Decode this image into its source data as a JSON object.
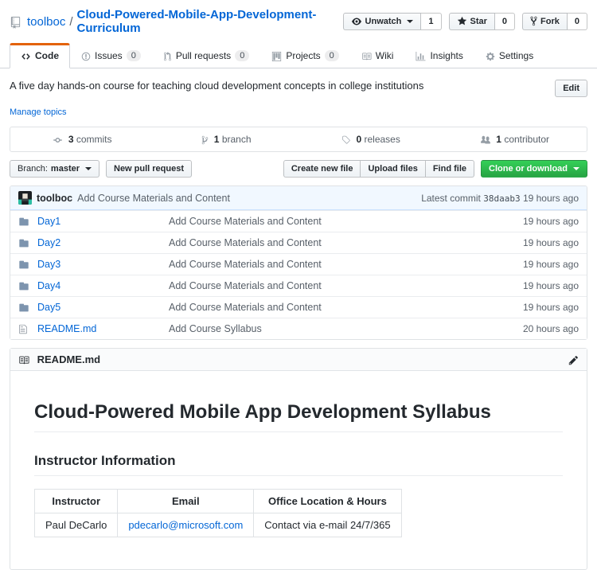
{
  "header": {
    "owner": "toolboc",
    "separator": "/",
    "repo_name": "Cloud-Powered-Mobile-App-Development-Curriculum",
    "watch": {
      "label": "Unwatch",
      "count": "1"
    },
    "star": {
      "label": "Star",
      "count": "0"
    },
    "fork": {
      "label": "Fork",
      "count": "0"
    }
  },
  "tabs": {
    "code": {
      "label": "Code"
    },
    "issues": {
      "label": "Issues",
      "count": "0"
    },
    "pulls": {
      "label": "Pull requests",
      "count": "0"
    },
    "projects": {
      "label": "Projects",
      "count": "0"
    },
    "wiki": {
      "label": "Wiki"
    },
    "insights": {
      "label": "Insights"
    },
    "settings": {
      "label": "Settings"
    }
  },
  "about": {
    "description": "A five day hands-on course for teaching cloud development concepts in college institutions",
    "edit_label": "Edit",
    "manage_topics_label": "Manage topics"
  },
  "stats": {
    "commits": {
      "count": "3",
      "label": "commits"
    },
    "branches": {
      "count": "1",
      "label": "branch"
    },
    "releases": {
      "count": "0",
      "label": "releases"
    },
    "contributors": {
      "count": "1",
      "label": "contributor"
    }
  },
  "toolbar": {
    "branch_label": "Branch:",
    "branch_value": "master",
    "new_pr_label": "New pull request",
    "create_file_label": "Create new file",
    "upload_label": "Upload files",
    "find_label": "Find file",
    "clone_label": "Clone or download"
  },
  "commit_bar": {
    "author": "toolboc",
    "message": "Add Course Materials and Content",
    "latest_label": "Latest commit",
    "hash": "38daab3",
    "time": "19 hours ago"
  },
  "files": {
    "rows": [
      {
        "name": "Day1",
        "message": "Add Course Materials and Content",
        "time": "19 hours ago"
      },
      {
        "name": "Day2",
        "message": "Add Course Materials and Content",
        "time": "19 hours ago"
      },
      {
        "name": "Day3",
        "message": "Add Course Materials and Content",
        "time": "19 hours ago"
      },
      {
        "name": "Day4",
        "message": "Add Course Materials and Content",
        "time": "19 hours ago"
      },
      {
        "name": "Day5",
        "message": "Add Course Materials and Content",
        "time": "19 hours ago"
      },
      {
        "name": "README.md",
        "message": "Add Course Syllabus",
        "time": "20 hours ago"
      }
    ]
  },
  "readme": {
    "filename": "README.md",
    "title": "Cloud-Powered Mobile App Development Syllabus",
    "section_heading": "Instructor Information",
    "table": {
      "headers": [
        "Instructor",
        "Email",
        "Office Location & Hours"
      ],
      "rows": [
        [
          "Paul DeCarlo",
          "pdecarlo@microsoft.com",
          "Contact via e-mail 24/7/365"
        ]
      ]
    }
  },
  "colors": {
    "link": "#0366d6",
    "tab_active_accent": "#e36209",
    "primary_button_green": "#28a745",
    "commit_header_bg": "#f1f8ff"
  }
}
